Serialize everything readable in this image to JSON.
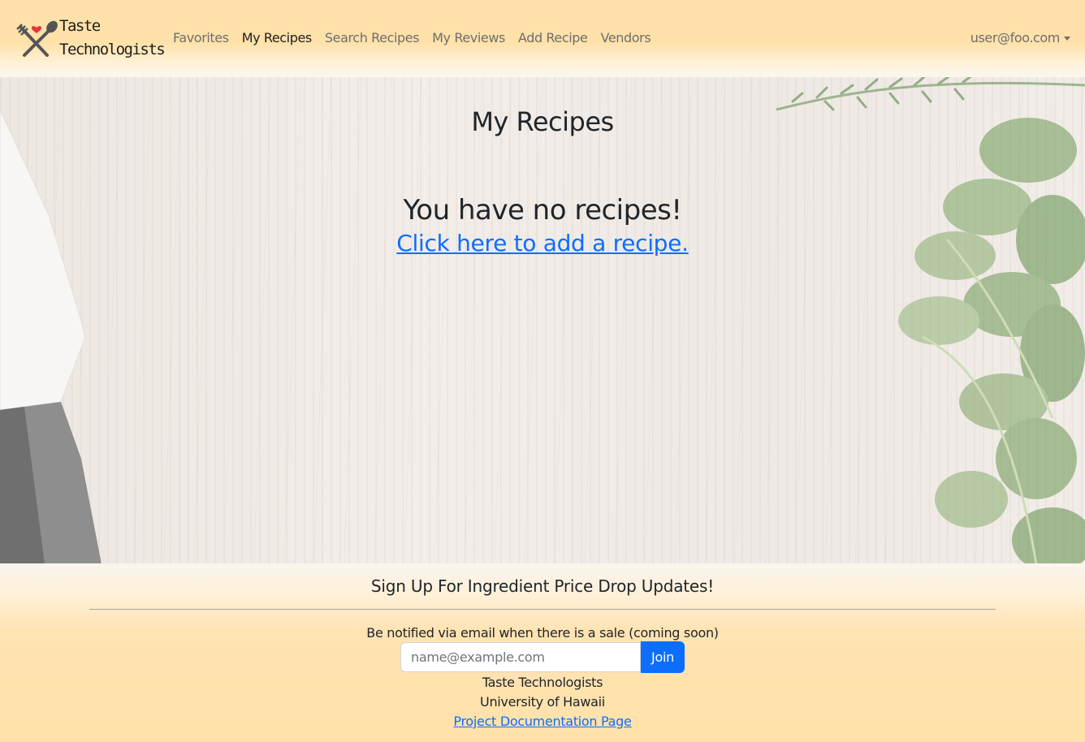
{
  "brand": {
    "line1": "Taste",
    "line2": "Technologists",
    "logo_icon": "heart-fork-spoon-icon"
  },
  "nav": {
    "items": [
      {
        "label": "Favorites",
        "active": false
      },
      {
        "label": "My Recipes",
        "active": true
      },
      {
        "label": "Search Recipes",
        "active": false
      },
      {
        "label": "My Reviews",
        "active": false
      },
      {
        "label": "Add Recipe",
        "active": false
      },
      {
        "label": "Vendors",
        "active": false
      }
    ],
    "user": "user@foo.com"
  },
  "main": {
    "title": "My Recipes",
    "empty_message": "You have no recipes!",
    "add_link": "Click here to add a recipe."
  },
  "footer": {
    "title": "Sign Up For Ingredient Price Drop Updates!",
    "subtitle": "Be notified via email when there is a sale (coming soon)",
    "email_placeholder": "name@example.com",
    "join_label": "Join",
    "org": "Taste Technologists",
    "university": "University of Hawaii",
    "doc_link": "Project Documentation Page"
  },
  "colors": {
    "nav_bg": "#ffe1a9",
    "link": "#0d6efd",
    "button": "#0d6efd",
    "active_nav": "#1f1f1f",
    "inactive_nav": "#6e6e6e"
  }
}
